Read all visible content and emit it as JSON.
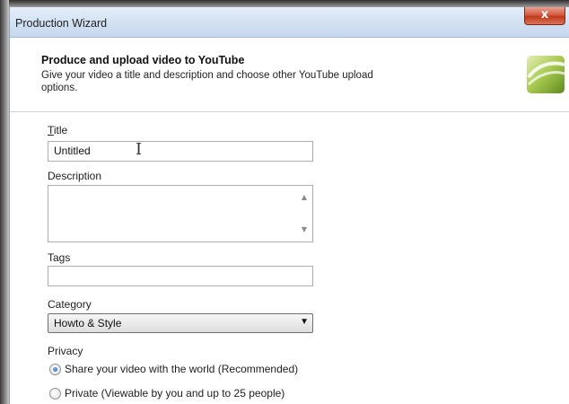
{
  "window": {
    "title": "Production Wizard",
    "close_label": "x"
  },
  "header": {
    "title": "Produce and upload video to YouTube",
    "subtitle": "Give your video a title and description and choose other YouTube upload options."
  },
  "form": {
    "title_label": "Title",
    "title_value": "Untitled",
    "description_label": "Description",
    "tags_label": "Tags",
    "category_label": "Category",
    "category_value": "Howto & Style",
    "privacy_label": "Privacy",
    "privacy_options": [
      {
        "label": "Share your video with the world (Recommended)",
        "selected": true
      },
      {
        "label": "Private (Viewable by you and up to 25 people)",
        "selected": false
      }
    ]
  },
  "icons": {
    "logo": "camtasia-logo-icon",
    "close": "close-icon",
    "text_cursor": "text-cursor-icon",
    "dropdown": "chevron-down-icon"
  },
  "colors": {
    "titlebar": "#d2e1f2",
    "close": "#c13a1c",
    "radio_selected": "#1f5fbf"
  }
}
